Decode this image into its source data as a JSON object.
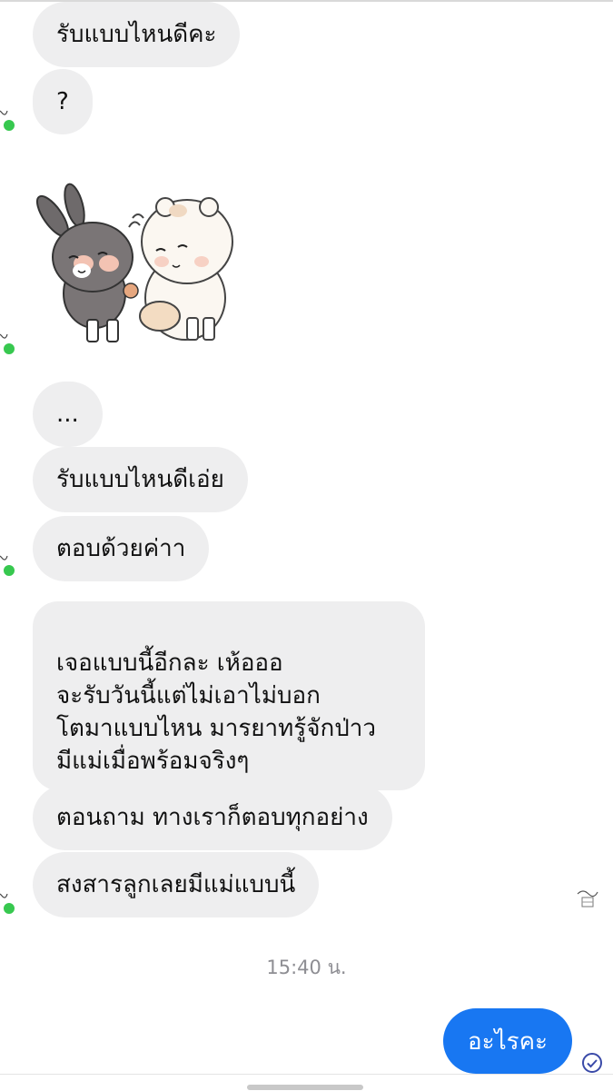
{
  "conversation": {
    "incoming_messages": [
      {
        "text": "รับแบบไหนดีคะ"
      },
      {
        "text": "?"
      },
      {
        "text": "..."
      },
      {
        "text": "รับแบบไหนดีเอ่ย"
      },
      {
        "text": "ตอบด้วยค่าา"
      },
      {
        "text": "เจอแบบนี้อีกละ เห้อออ\nจะรับวันนี้แต่ไม่เอาไม่บอก\nโตมาแบบไหน มารยาทรู้จักป่าว\nมีแม่เมื่อพร้อมจริงๆ"
      },
      {
        "text": "ตอนถาม ทางเราก็ตอบทุกอย่าง"
      },
      {
        "text": "สงสารลูกเลยมีแม่แบบนี้"
      }
    ],
    "sticker": {
      "name": "bunny-and-bear-sticker"
    },
    "timestamp": "15:40 น.",
    "outgoing_message": {
      "text": "อะไรคะ"
    },
    "colors": {
      "incoming_bubble": "#eeeeef",
      "outgoing_bubble": "#1877f2",
      "online_dot": "#37c84f"
    }
  }
}
